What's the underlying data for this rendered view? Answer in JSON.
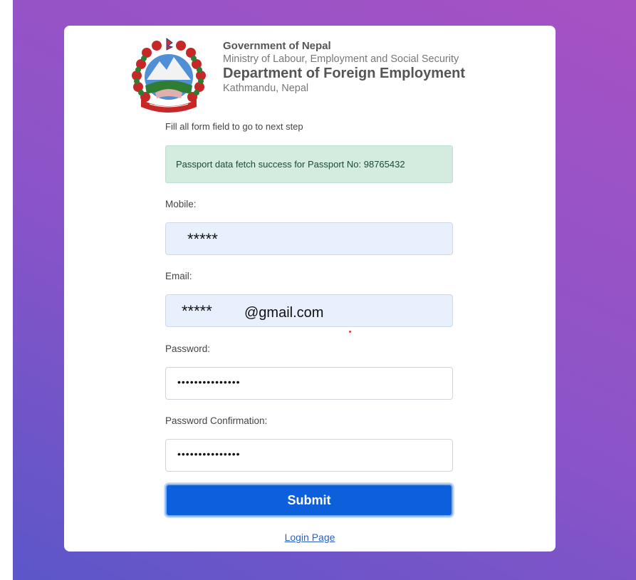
{
  "header": {
    "line1": "Government of Nepal",
    "line2": "Ministry of Labour, Employment and Social Security",
    "line3": "Department of Foreign Employment",
    "line4": "Kathmandu, Nepal"
  },
  "hint": "Fill all form field to go to next step",
  "alert": "Passport data fetch success for Passport No: 98765432",
  "form": {
    "mobile_label": "Mobile:",
    "mobile_value": "*****",
    "email_label": "Email:",
    "email_masked": "*****",
    "email_domain": "@gmail.com",
    "password_label": "Password:",
    "password_value": "•••••••••••••••",
    "confirm_label": "Password Confirmation:",
    "confirm_value": "•••••••••••••••",
    "submit_label": "Submit",
    "login_link": "Login Page"
  },
  "colors": {
    "background_start": "#5b56c9",
    "background_end": "#a652c4",
    "submit": "#0d5fdc",
    "alert_bg": "#d4ebe0",
    "filled_input_bg": "#e8f0fe"
  },
  "icons": {
    "emblem": "nepal-emblem"
  }
}
